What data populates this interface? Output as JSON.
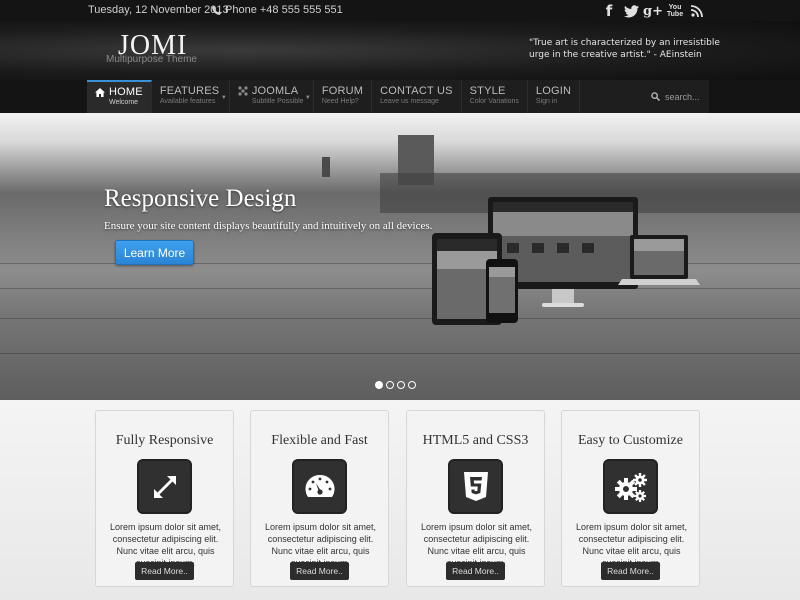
{
  "topbar": {
    "date": "Tuesday, 12 November 2013",
    "phone": "Phone +48 555 555 551",
    "social": [
      {
        "name": "facebook-icon",
        "glyph": "f"
      },
      {
        "name": "twitter-icon",
        "glyph": ""
      },
      {
        "name": "google-plus-icon",
        "glyph": "g+"
      },
      {
        "name": "youtube-icon",
        "glyph": "You\nTube"
      },
      {
        "name": "rss-icon",
        "glyph": ""
      }
    ]
  },
  "header": {
    "logo": "JOMI",
    "tagline": "Multipurpose Theme",
    "quote": "\"True art is characterized by an irresistible urge in the creative artist.\" - AEinstein"
  },
  "nav": {
    "items": [
      {
        "label": "HOME",
        "sub": "Welcome",
        "active": true,
        "icon": "home-icon"
      },
      {
        "label": "FEATURES",
        "sub": "Available features",
        "caret": true
      },
      {
        "label": "JOOMLA",
        "sub": "Subtitle Possible",
        "icon": "joomla-icon",
        "caret": true
      },
      {
        "label": "FORUM",
        "sub": "Need Help?"
      },
      {
        "label": "CONTACT US",
        "sub": "Leave us message"
      },
      {
        "label": "STYLE",
        "sub": "Color Variations"
      },
      {
        "label": "LOGIN",
        "sub": "Sign in"
      }
    ],
    "search_placeholder": "search..."
  },
  "hero": {
    "title": "Responsive Design",
    "subtitle": "Ensure your site content displays beautifully and intuitively on all devices.",
    "button": "Learn More",
    "slides": 4,
    "active_slide": 1
  },
  "features": [
    {
      "title": "Fully Responsive",
      "icon": "expand-arrows-icon",
      "text": "Lorem ipsum dolor sit amet, consectetur adipiscing elit. Nunc vitae elit arcu, quis suscipit ipsum.",
      "button": "Read More.."
    },
    {
      "title": "Flexible and Fast",
      "icon": "speedometer-icon",
      "text": "Lorem ipsum dolor sit amet, consectetur adipiscing elit. Nunc vitae elit arcu, quis suscipit ipsum.",
      "button": "Read More.."
    },
    {
      "title": "HTML5 and CSS3",
      "icon": "html5-icon",
      "text": "Lorem ipsum dolor sit amet, consectetur adipiscing elit. Nunc vitae elit arcu, quis suscipit ipsum.",
      "button": "Read More.."
    },
    {
      "title": "Easy to Customize",
      "icon": "gears-icon",
      "text": "Lorem ipsum dolor sit amet, consectetur adipiscing elit. Nunc vitae elit arcu, quis suscipit ipsum.",
      "button": "Read More.."
    }
  ],
  "colors": {
    "accent": "#3a8fd6",
    "button": "#2b84d6",
    "topbar": "#141414",
    "card_icon": "#303030"
  }
}
